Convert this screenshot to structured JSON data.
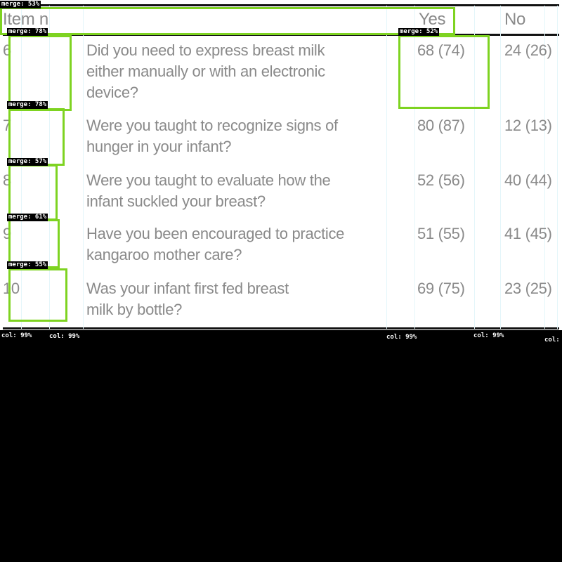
{
  "table": {
    "headers": {
      "item": "Item n",
      "yes": "Yes",
      "no": "No"
    },
    "rows": [
      {
        "item": "6",
        "question": "Did you need to express breast milk\neither manually or with an electronic\ndevice?",
        "yes": "68 (74)",
        "no": "24 (26)"
      },
      {
        "item": "7",
        "question": "Were you taught to recognize signs of\nhunger in your infant?",
        "yes": "80 (87)",
        "no": "12 (13)"
      },
      {
        "item": "8",
        "question": "Were you taught to evaluate how the\ninfant suckled your breast?",
        "yes": "52 (56)",
        "no": "40 (44)"
      },
      {
        "item": "9",
        "question": "Have you been encouraged to practice\nkangaroo mother care?",
        "yes": "51 (55)",
        "no": "41 (45)"
      },
      {
        "item": "10",
        "question": "Was your infant first fed breast\nmilk by bottle?",
        "yes": "69 (75)",
        "no": "23 (25)"
      }
    ]
  },
  "annotations": {
    "merge_tags": [
      "merge: 53%",
      "merge: 78%",
      "merge: 52%",
      "merge: 78%",
      "merge: 57%",
      "merge: 61%",
      "merge: 55%"
    ],
    "col_tags": [
      "col: 99%",
      "col: 99%",
      "col: 99%",
      "col: 99%",
      "col:"
    ]
  },
  "colors": {
    "box_outline": "#7ed321",
    "text": "#8a8a8a",
    "rule": "#111111",
    "background": "#000000"
  }
}
